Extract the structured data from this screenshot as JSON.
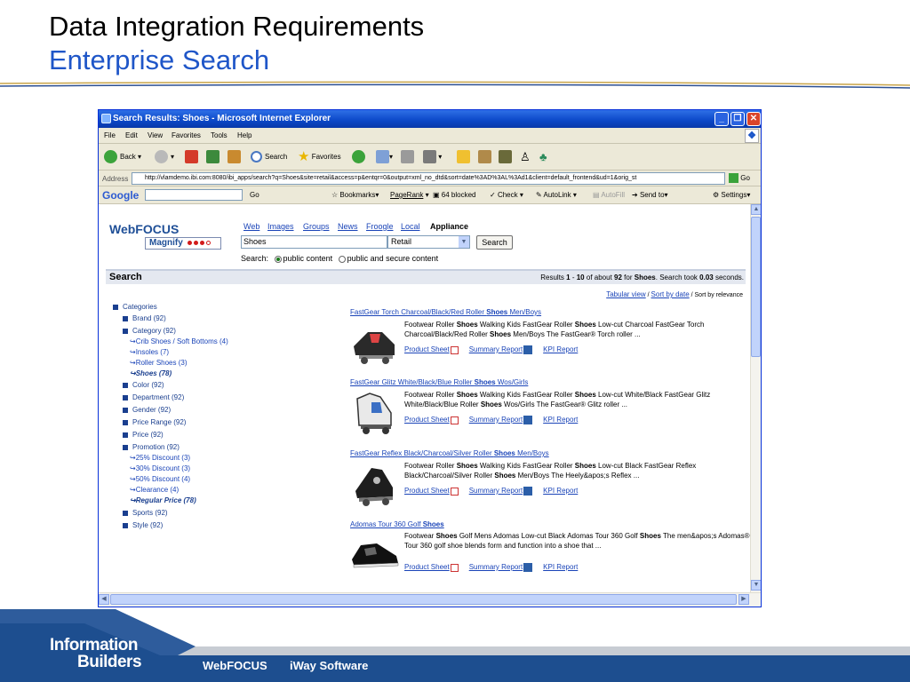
{
  "slide": {
    "title": "Data Integration Requirements",
    "subtitle": "Enterprise Search",
    "footer": {
      "logo_line1": "Information",
      "logo_line2": "Builders",
      "links": [
        "WebFOCUS",
        "iWay Software"
      ]
    }
  },
  "browser": {
    "title": "Search Results: Shoes - Microsoft Internet Explorer",
    "menu": [
      "File",
      "Edit",
      "View",
      "Favorites",
      "Tools",
      "Help"
    ],
    "toolbar": {
      "back": "Back",
      "search": "Search",
      "favorites": "Favorites"
    },
    "address_label": "Address",
    "address_url": "http://vlamdemo.ibi.com:8080/ibi_apps/search?q=Shoes&site=retail&access=p&entqr=0&output=xml_no_dtd&sort=date%3AD%3AL%3Ad1&client=default_frontend&ud=1&orig_st",
    "go_label": "Go",
    "google_bar": {
      "brand": "Google",
      "go": "Go",
      "bookmarks": "Bookmarks",
      "pagerank": "PageRank",
      "blocked": "64 blocked",
      "check": "Check",
      "autolink": "AutoLink",
      "autofill": "AutoFill",
      "sendto": "Send to",
      "settings": "Settings"
    }
  },
  "webfocus": {
    "logo": "WebFOCUS",
    "magnify": "Magnify",
    "tabs": [
      "Web",
      "Images",
      "Groups",
      "News",
      "Froogle",
      "Local"
    ],
    "active_tab": "Appliance",
    "query": "Shoes",
    "collection": "Retail",
    "search_button": "Search",
    "scope_label": "Search:",
    "scope_options": [
      "public content",
      "public and secure content"
    ],
    "heading": "Search",
    "results_info": {
      "prefix": "Results",
      "from": "1",
      "to": "10",
      "of_about": "of about",
      "total": "92",
      "for_word": "for",
      "query": "Shoes",
      "took": "Search took",
      "seconds": "0.03",
      "seconds_label": "seconds."
    },
    "sort": {
      "tabular": "Tabular view",
      "sort_by_date": "Sort by date",
      "sort_by_relevance": "Sort by relevance"
    },
    "categories": {
      "root": "Categories",
      "items": [
        {
          "label": "Brand  (92)"
        },
        {
          "label": "Category  (92)"
        },
        {
          "label": "Color  (92)"
        },
        {
          "label": "Department  (92)"
        },
        {
          "label": "Gender  (92)"
        },
        {
          "label": "Price Range  (92)"
        },
        {
          "label": "Price  (92)"
        },
        {
          "label": "Promotion  (92)"
        },
        {
          "label": "Sports  (92)"
        },
        {
          "label": "Style  (92)"
        }
      ],
      "category_subitems": [
        "Crib Shoes / Soft Bottoms (4)",
        "Insoles (7)",
        "Roller Shoes (3)",
        "Shoes (78)"
      ],
      "promotion_subitems": [
        "25% Discount (3)",
        "30% Discount (3)",
        "50% Discount (4)",
        "Clearance (4)",
        "Regular Price (78)"
      ]
    },
    "results": [
      {
        "title_pre": "FastGear Torch Charcoal/Black/Red Roller ",
        "title_bold": "Shoes",
        "title_post": " Men/Boys",
        "snippet": "Footwear Roller Shoes Walking Kids FastGear Roller Shoes Low-cut Charcoal FastGear Torch Charcoal/Black/Red Roller Shoes Men/Boys The FastGear® Torch roller ..."
      },
      {
        "title_pre": "FastGear Glitz White/Black/Blue Roller ",
        "title_bold": "Shoes",
        "title_post": " Wos/Girls",
        "snippet": "Footwear Roller Shoes Walking Kids FastGear Roller Shoes Low-cut White/Black FastGear Glitz White/Black/Blue Roller Shoes Wos/Girls The FastGear® Glitz roller ..."
      },
      {
        "title_pre": "FastGear Reflex Black/Charcoal/Silver Roller ",
        "title_bold": "Shoes",
        "title_post": " Men/Boys",
        "snippet": "Footwear Roller Shoes Walking Kids FastGear Roller Shoes Low-cut Black FastGear Reflex Black/Charcoal/Silver Roller Shoes Men/Boys The Heely&apos;s Reflex ..."
      },
      {
        "title_pre": "Adomas Tour 360 Golf ",
        "title_bold": "Shoes",
        "title_post": "",
        "snippet": "Footwear Shoes Golf Mens Adomas Low-cut Black Adomas Tour 360 Golf Shoes The men&apos;s Adomas® Tour 360 golf shoe blends form and function into a shoe that ..."
      }
    ],
    "result_links": [
      "Product Sheet",
      "Summary Report",
      "KPI Report"
    ]
  },
  "colors": {
    "accent_blue": "#1f56c8",
    "link_blue": "#1a44b8",
    "footer_blue": "#1d4e8f",
    "titlebar_blue": "#0a47c7"
  }
}
